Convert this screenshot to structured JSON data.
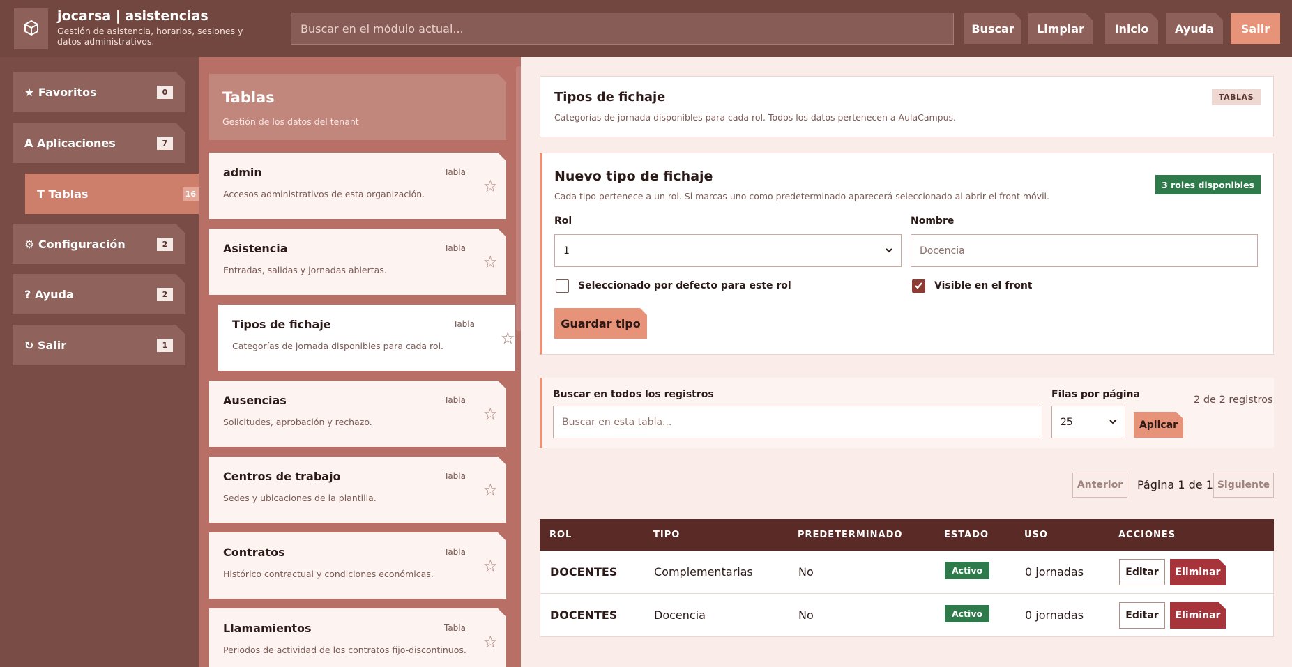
{
  "header": {
    "app_name": "jocarsa | asistencias",
    "app_subtitle": "Gestión de asistencia, horarios, sesiones y datos administrativos.",
    "logo_icon": "cube-icon",
    "search_placeholder": "Buscar en el módulo actual...",
    "buttons": {
      "buscar": "Buscar",
      "limpiar": "Limpiar",
      "inicio": "Inicio",
      "ayuda": "Ayuda",
      "salir": "Salir"
    }
  },
  "sidebar": {
    "items": [
      {
        "label": "★ Favoritos",
        "count": "0"
      },
      {
        "label": "A Aplicaciones",
        "count": "7"
      },
      {
        "label": "T Tablas",
        "count": "16"
      },
      {
        "label": "⚙ Configuración",
        "count": "2"
      },
      {
        "label": "? Ayuda",
        "count": "2"
      },
      {
        "label": "↻ Salir",
        "count": "1"
      }
    ]
  },
  "tables_panel": {
    "title": "Tablas",
    "subtitle": "Gestión de los datos del tenant",
    "cards": [
      {
        "title": "admin",
        "desc": "Accesos administrativos de esta organización.",
        "kind": "Tabla"
      },
      {
        "title": "Asistencia",
        "desc": "Entradas, salidas y jornadas abiertas.",
        "kind": "Tabla"
      },
      {
        "title": "Tipos de fichaje",
        "desc": "Categorías de jornada disponibles para cada rol.",
        "kind": "Tabla"
      },
      {
        "title": "Ausencias",
        "desc": "Solicitudes, aprobación y rechazo.",
        "kind": "Tabla"
      },
      {
        "title": "Centros de trabajo",
        "desc": "Sedes y ubicaciones de la plantilla.",
        "kind": "Tabla"
      },
      {
        "title": "Contratos",
        "desc": "Histórico contractual y condiciones económicas.",
        "kind": "Tabla"
      },
      {
        "title": "Llamamientos",
        "desc": "Periodos de actividad de los contratos fijo-discontinuos.",
        "kind": "Tabla"
      }
    ]
  },
  "main": {
    "title": "Tipos de fichaje",
    "subtitle": "Categorías de jornada disponibles para cada rol. Todos los datos pertenecen a AulaCampus.",
    "tag": "TABLAS",
    "form": {
      "title": "Nuevo tipo de fichaje",
      "subtitle": "Cada tipo pertenece a un rol. Si marcas uno como predeterminado aparecerá seleccionado al abrir el front móvil.",
      "badge": "3 roles disponibles",
      "rol_label": "Rol",
      "rol_value": "1",
      "nombre_label": "Nombre",
      "nombre_placeholder": "Docencia",
      "default_label": "Seleccionado por defecto para este rol",
      "visible_label": "Visible en el front",
      "save_label": "Guardar tipo"
    },
    "search": {
      "label": "Buscar en todos los registros",
      "placeholder": "Buscar en esta tabla...",
      "rows_label": "Filas por página",
      "rows_value": "25",
      "apply_label": "Aplicar",
      "count_text": "2 de 2 registros"
    },
    "pagination": {
      "prev": "Anterior",
      "page_text": "Página 1 de 1",
      "next": "Siguiente"
    },
    "table": {
      "columns": [
        "ROL",
        "TIPO",
        "PREDETERMINADO",
        "ESTADO",
        "USO",
        "ACCIONES"
      ],
      "rows": [
        {
          "rol": "DOCENTES",
          "tipo": "Complementarias",
          "predeterminado": "No",
          "estado": "Activo",
          "uso": "0 jornadas",
          "edit": "Editar",
          "delete": "Eliminar"
        },
        {
          "rol": "DOCENTES",
          "tipo": "Docencia",
          "predeterminado": "No",
          "estado": "Activo",
          "uso": "0 jornadas",
          "edit": "Editar",
          "delete": "Eliminar"
        }
      ]
    }
  },
  "colors": {
    "topbar": "#724740",
    "accent": "#e6937a",
    "sidebar_active": "#ce7f6c",
    "table_header": "#5a2b26",
    "success": "#2f7a4a",
    "danger": "#a8343b"
  }
}
